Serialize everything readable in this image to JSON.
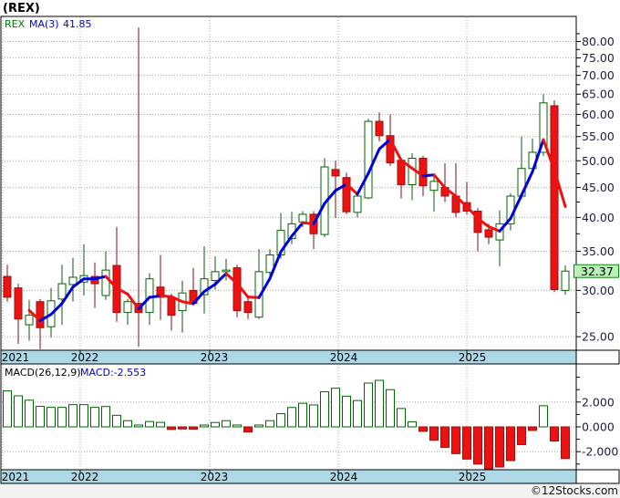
{
  "window": {
    "title": "(REX)"
  },
  "legend": {
    "symbol": "REX",
    "ma_label": "MA(3)",
    "ma_value": "41.85"
  },
  "macd_header": {
    "label": "MACD(26,12,9)",
    "value": "MACD:-2.553"
  },
  "current_price": {
    "value": "32.37",
    "price": 32.37
  },
  "footer": {
    "credit": "©12Stocks.com"
  },
  "colors": {
    "up_border": "#006600",
    "up_fill": "#ffffff",
    "up_wick": "#115511",
    "down_border": "#991111",
    "down_fill": "#ee1111",
    "down_wick": "#771111",
    "ma_up": "#0000dd",
    "ma_down": "#ee1111",
    "grid": "#a8a8a8",
    "panel_border": "#000000",
    "band_bg": "#add8e6",
    "axis_text": "#202040",
    "price_box_bg": "#b9f2b9",
    "price_box_border": "#118811",
    "legend_symbol": "#007700",
    "legend_value": "#0000cc",
    "macd_value_color": "#0000cc",
    "footer_bg": "#f2f2f2"
  },
  "x_axis": {
    "years": [
      "2021",
      "2022",
      "2023",
      "2024",
      "2025"
    ]
  },
  "chart_data": [
    {
      "type": "candlestick",
      "title": "(REX)",
      "overlay": {
        "name": "MA(3)",
        "period": 3,
        "last_value": 41.85,
        "rising_color": "blue",
        "falling_color": "red"
      },
      "y_axis": {
        "scale": "log",
        "side": "right",
        "ticks": [
          80,
          75,
          70,
          65,
          60,
          55,
          50,
          45,
          40,
          35,
          30,
          25
        ],
        "minor_ticks": [
          82.5,
          77.5,
          72.5,
          67.5,
          62.5,
          57.5,
          52.5,
          47.5,
          42.5,
          37.5,
          32.5,
          27.5
        ],
        "ylim": [
          23.7,
          88.3
        ],
        "current_price": 32.37
      },
      "grid": true,
      "months": [
        "2021-06",
        "2021-07",
        "2021-08",
        "2021-09",
        "2021-10",
        "2021-11",
        "2021-12",
        "2022-01",
        "2022-02",
        "2022-03",
        "2022-04",
        "2022-05",
        "2022-06",
        "2022-07",
        "2022-08",
        "2022-09",
        "2022-10",
        "2022-11",
        "2022-12",
        "2023-01",
        "2023-02",
        "2023-03",
        "2023-04",
        "2023-05",
        "2023-06",
        "2023-07",
        "2023-08",
        "2023-09",
        "2023-10",
        "2023-11",
        "2023-12",
        "2024-01",
        "2024-02",
        "2024-03",
        "2024-04",
        "2024-05",
        "2024-06",
        "2024-07",
        "2024-08",
        "2024-09",
        "2024-10",
        "2024-11",
        "2024-12",
        "2025-01",
        "2025-02",
        "2025-03",
        "2025-04",
        "2025-05",
        "2025-06",
        "2025-07",
        "2025-08",
        "2025-09"
      ],
      "ohlc": [
        [
          31.7,
          33.2,
          28.7,
          29.2
        ],
        [
          30.3,
          30.8,
          24.3,
          26.8
        ],
        [
          26.2,
          28.9,
          24.6,
          27.2
        ],
        [
          28.7,
          29.0,
          23.8,
          25.9
        ],
        [
          26.0,
          30.3,
          24.9,
          28.8
        ],
        [
          29.0,
          33.2,
          26.2,
          30.8
        ],
        [
          30.7,
          34.1,
          28.7,
          31.6
        ],
        [
          31.0,
          36.0,
          29.4,
          31.8
        ],
        [
          31.7,
          33.5,
          28.0,
          30.8
        ],
        [
          29.4,
          35.0,
          28.9,
          32.5
        ],
        [
          33.1,
          38.5,
          26.5,
          27.5
        ],
        [
          27.5,
          29.0,
          26.2,
          28.7
        ],
        [
          28.5,
          84.5,
          24.0,
          27.5
        ],
        [
          27.5,
          32.1,
          26.2,
          31.4
        ],
        [
          30.4,
          34.5,
          26.7,
          29.2
        ],
        [
          29.2,
          29.6,
          25.6,
          27.2
        ],
        [
          27.7,
          31.2,
          25.4,
          29.7
        ],
        [
          30.0,
          32.8,
          28.3,
          28.5
        ],
        [
          29.5,
          35.7,
          27.4,
          31.4
        ],
        [
          31.2,
          34.3,
          30.1,
          32.3
        ],
        [
          32.3,
          34.0,
          31.2,
          32.5
        ],
        [
          32.8,
          33.2,
          27.0,
          27.7
        ],
        [
          28.7,
          29.3,
          26.8,
          27.5
        ],
        [
          27.0,
          35.3,
          26.8,
          32.3
        ],
        [
          32.2,
          35.3,
          31.5,
          34.5
        ],
        [
          34.5,
          40.7,
          34.0,
          38.0
        ],
        [
          36.8,
          40.9,
          36.0,
          39.0
        ],
        [
          39.3,
          41.0,
          38.5,
          40.5
        ],
        [
          40.5,
          41.0,
          35.3,
          37.5
        ],
        [
          37.4,
          50.5,
          37.0,
          48.8
        ],
        [
          48.3,
          50.0,
          39.9,
          47.1
        ],
        [
          46.8,
          47.7,
          40.5,
          40.9
        ],
        [
          40.8,
          44.0,
          40.0,
          43.5
        ],
        [
          43.2,
          59.0,
          43.0,
          58.4
        ],
        [
          58.4,
          60.5,
          54.0,
          55.2
        ],
        [
          55.2,
          60.0,
          49.0,
          49.6
        ],
        [
          50.1,
          50.5,
          43.1,
          45.5
        ],
        [
          45.5,
          51.5,
          42.8,
          50.5
        ],
        [
          50.5,
          51.0,
          43.5,
          45.3
        ],
        [
          44.5,
          47.0,
          40.9,
          46.1
        ],
        [
          45.0,
          49.5,
          42.5,
          43.5
        ],
        [
          43.5,
          49.5,
          40.0,
          40.8
        ],
        [
          42.4,
          46.0,
          40.5,
          41.0
        ],
        [
          41.0,
          41.5,
          35.0,
          37.7
        ],
        [
          38.1,
          39.0,
          36.0,
          37.0
        ],
        [
          36.6,
          41.1,
          33.0,
          39.0
        ],
        [
          39.0,
          44.0,
          38.0,
          43.5
        ],
        [
          43.5,
          55.0,
          43.0,
          48.5
        ],
        [
          48.5,
          54.6,
          48.0,
          51.7
        ],
        [
          51.7,
          65.0,
          51.0,
          62.8
        ],
        [
          62.1,
          63.5,
          29.8,
          30.1
        ],
        [
          30.0,
          33.1,
          29.5,
          32.37
        ]
      ]
    },
    {
      "type": "bar",
      "title": "MACD(26,12,9)",
      "last_value": -2.553,
      "y_axis": {
        "side": "right",
        "ticks": [
          2,
          0,
          -2
        ],
        "minor_ticks": [
          4,
          3,
          1,
          -1,
          -3
        ],
        "ylim": [
          -3.46,
          5.07
        ]
      },
      "bar_color_rule": "green hollow if value >= 0, solid red if value < 0",
      "values": [
        2.9,
        2.5,
        2.15,
        1.65,
        1.57,
        1.57,
        1.79,
        1.79,
        1.57,
        1.64,
        0.93,
        0.5,
        0.14,
        0.43,
        0.36,
        -0.21,
        -0.17,
        -0.19,
        0.05,
        0.35,
        0.5,
        0.02,
        -0.42,
        0.02,
        0.5,
        1.06,
        1.56,
        1.9,
        1.77,
        2.83,
        3.11,
        2.47,
        2.12,
        3.53,
        3.75,
        3.0,
        1.48,
        0.4,
        -0.36,
        -1.08,
        -1.65,
        -2.16,
        -2.6,
        -3.0,
        -3.38,
        -3.24,
        -2.72,
        -1.44,
        -0.29,
        1.7,
        -1.14,
        -2.553
      ]
    }
  ]
}
